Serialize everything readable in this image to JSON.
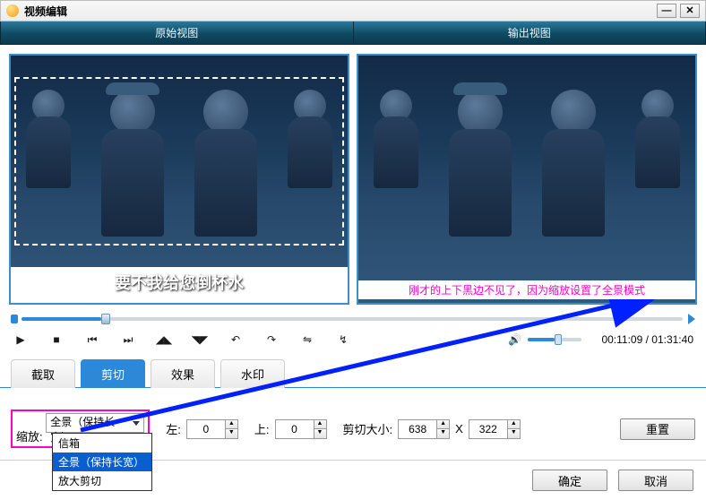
{
  "window": {
    "title": "视频编辑",
    "minimize": "—",
    "close": "✕"
  },
  "headerTabs": {
    "left": "原始视图",
    "right": "输出视图"
  },
  "preview": {
    "subtitle": "要不我给您倒杯水",
    "output_caption": "刚才的上下黑边不见了，因为缩放设置了全景模式"
  },
  "timecode": {
    "current": "00:11:09",
    "total": "01:31:40",
    "sep": " / "
  },
  "editTabs": {
    "crop": "截取",
    "cut": "剪切",
    "effect": "效果",
    "watermark": "水印"
  },
  "panel": {
    "zoom_label": "缩放:",
    "zoom_selected": "全景（保持长宽）",
    "zoom_options": [
      "信箱",
      "全景（保持长宽）",
      "放大剪切"
    ],
    "left_label": "左:",
    "left_value": "0",
    "top_label": "上:",
    "top_value": "0",
    "cutsize_label": "剪切大小:",
    "cut_w": "638",
    "cut_x": "X",
    "cut_h": "322",
    "reset": "重置"
  },
  "footer": {
    "ok": "确定",
    "cancel": "取消"
  },
  "icons": {
    "play": "▶",
    "stop": "■",
    "prev": "⏮",
    "next": "⏭",
    "markin": "◢◣",
    "markout": "◥◤",
    "rotl": "↶",
    "rotr": "↷",
    "fliph": "⇋",
    "flipv": "↯",
    "volume": "🔊"
  }
}
